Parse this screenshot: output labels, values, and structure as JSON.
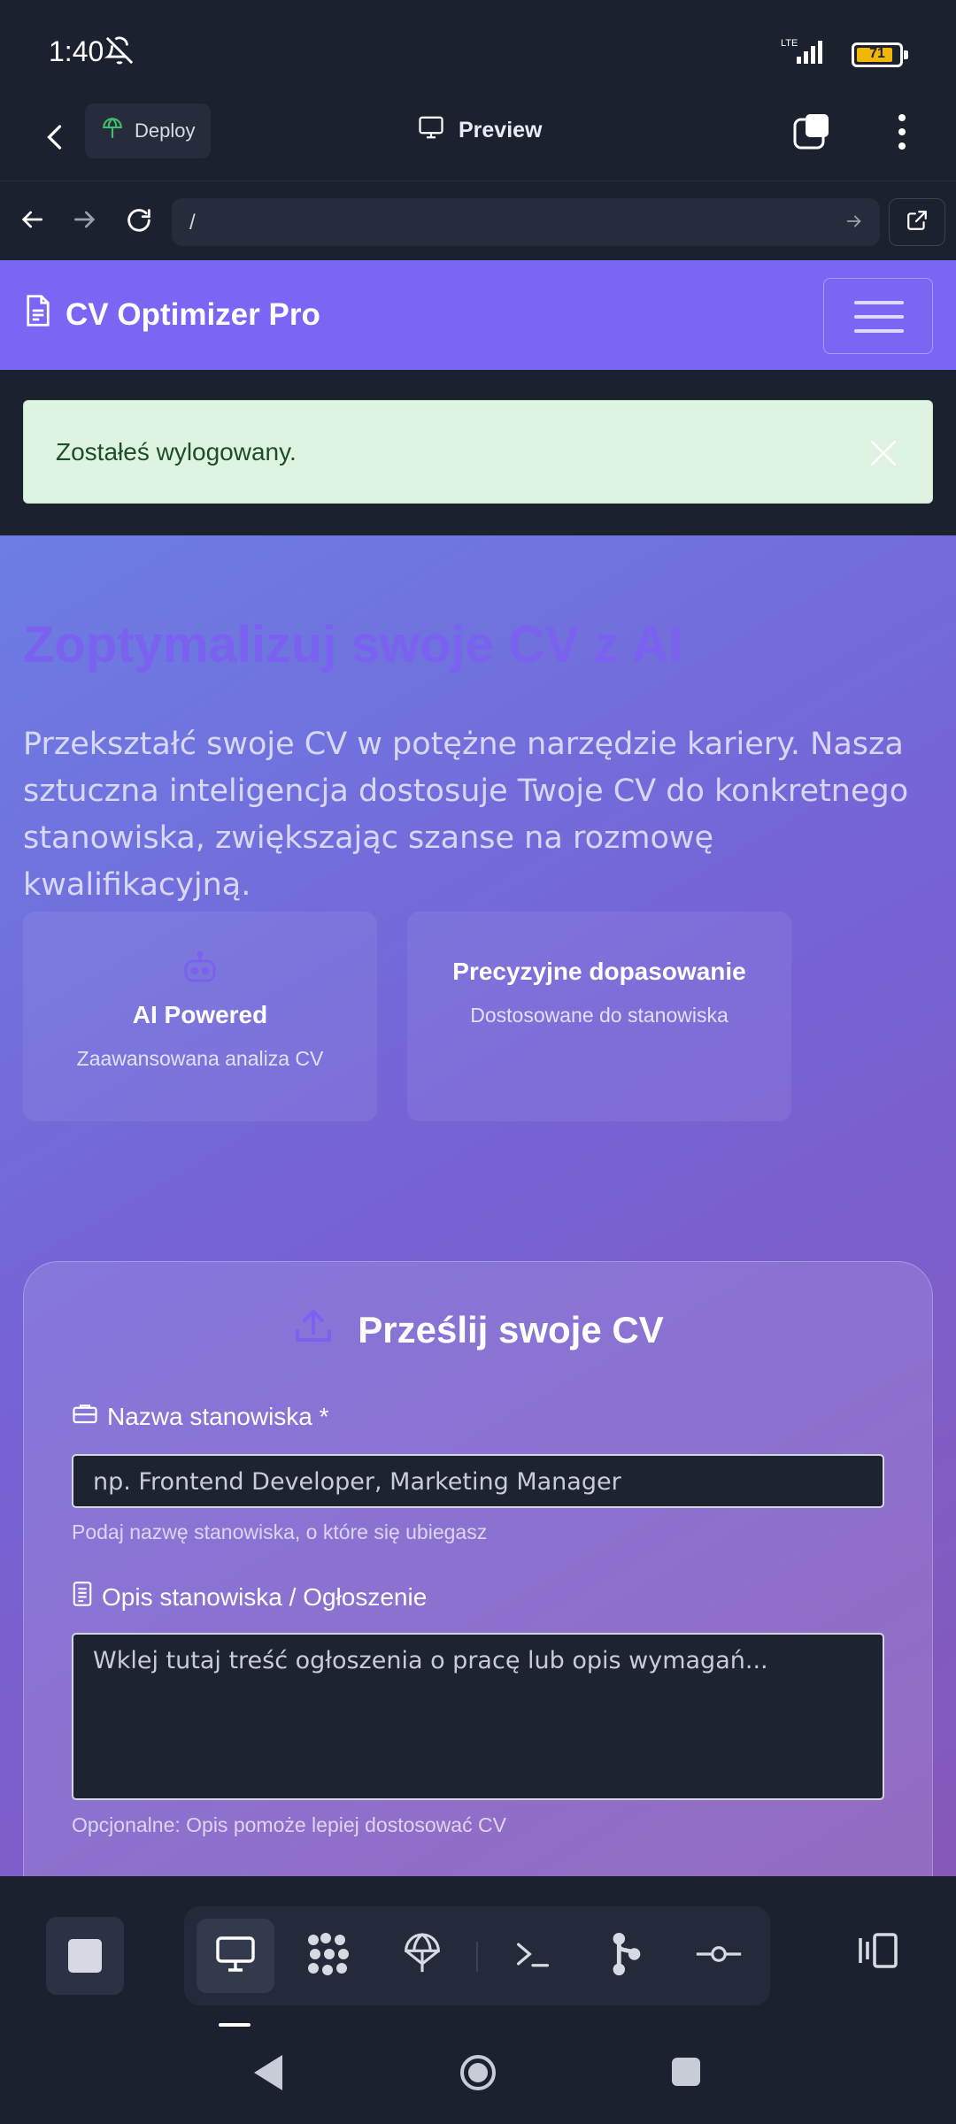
{
  "status_bar": {
    "time": "1:40",
    "network": "LTE",
    "battery": "71"
  },
  "app_header": {
    "deploy_label": "Deploy",
    "preview_label": "Preview"
  },
  "browser": {
    "url": "/"
  },
  "site": {
    "brand": "CV Optimizer Pro",
    "alert": "Zostałeś wylogowany.",
    "hero_title": "Zoptymalizuj swoje CV z AI",
    "hero_lead": "Przekształć swoje CV w potężne narzędzie kariery. Nasza sztuczna inteligencja dostosuje Twoje CV do konkretnego stanowiska, zwiększając szanse na rozmowę kwalifikacyjną.",
    "features": [
      {
        "title": "AI Powered",
        "subtitle": "Zaawansowana analiza CV",
        "icon": "robot-icon"
      },
      {
        "title": "Precyzyjne dopasowanie",
        "subtitle": "Dostosowane do stanowiska"
      }
    ],
    "upload_card": {
      "title": "Prześlij swoje CV",
      "job_title_label": "Nazwa stanowiska *",
      "job_title_placeholder": "np. Frontend Developer, Marketing Manager",
      "job_title_help": "Podaj nazwę stanowiska, o które się ubiegasz",
      "description_label": "Opis stanowiska / Ogłoszenie",
      "description_placeholder": "Wklej tutaj treść ogłoszenia o pracę lub opis wymagań...",
      "description_help": "Opcjonalne: Opis pomoże lepiej dostosować CV"
    }
  },
  "colors": {
    "brand": "#7a66f5",
    "alert_bg": "#dff3e1",
    "hero_title": "#7b61f0"
  }
}
